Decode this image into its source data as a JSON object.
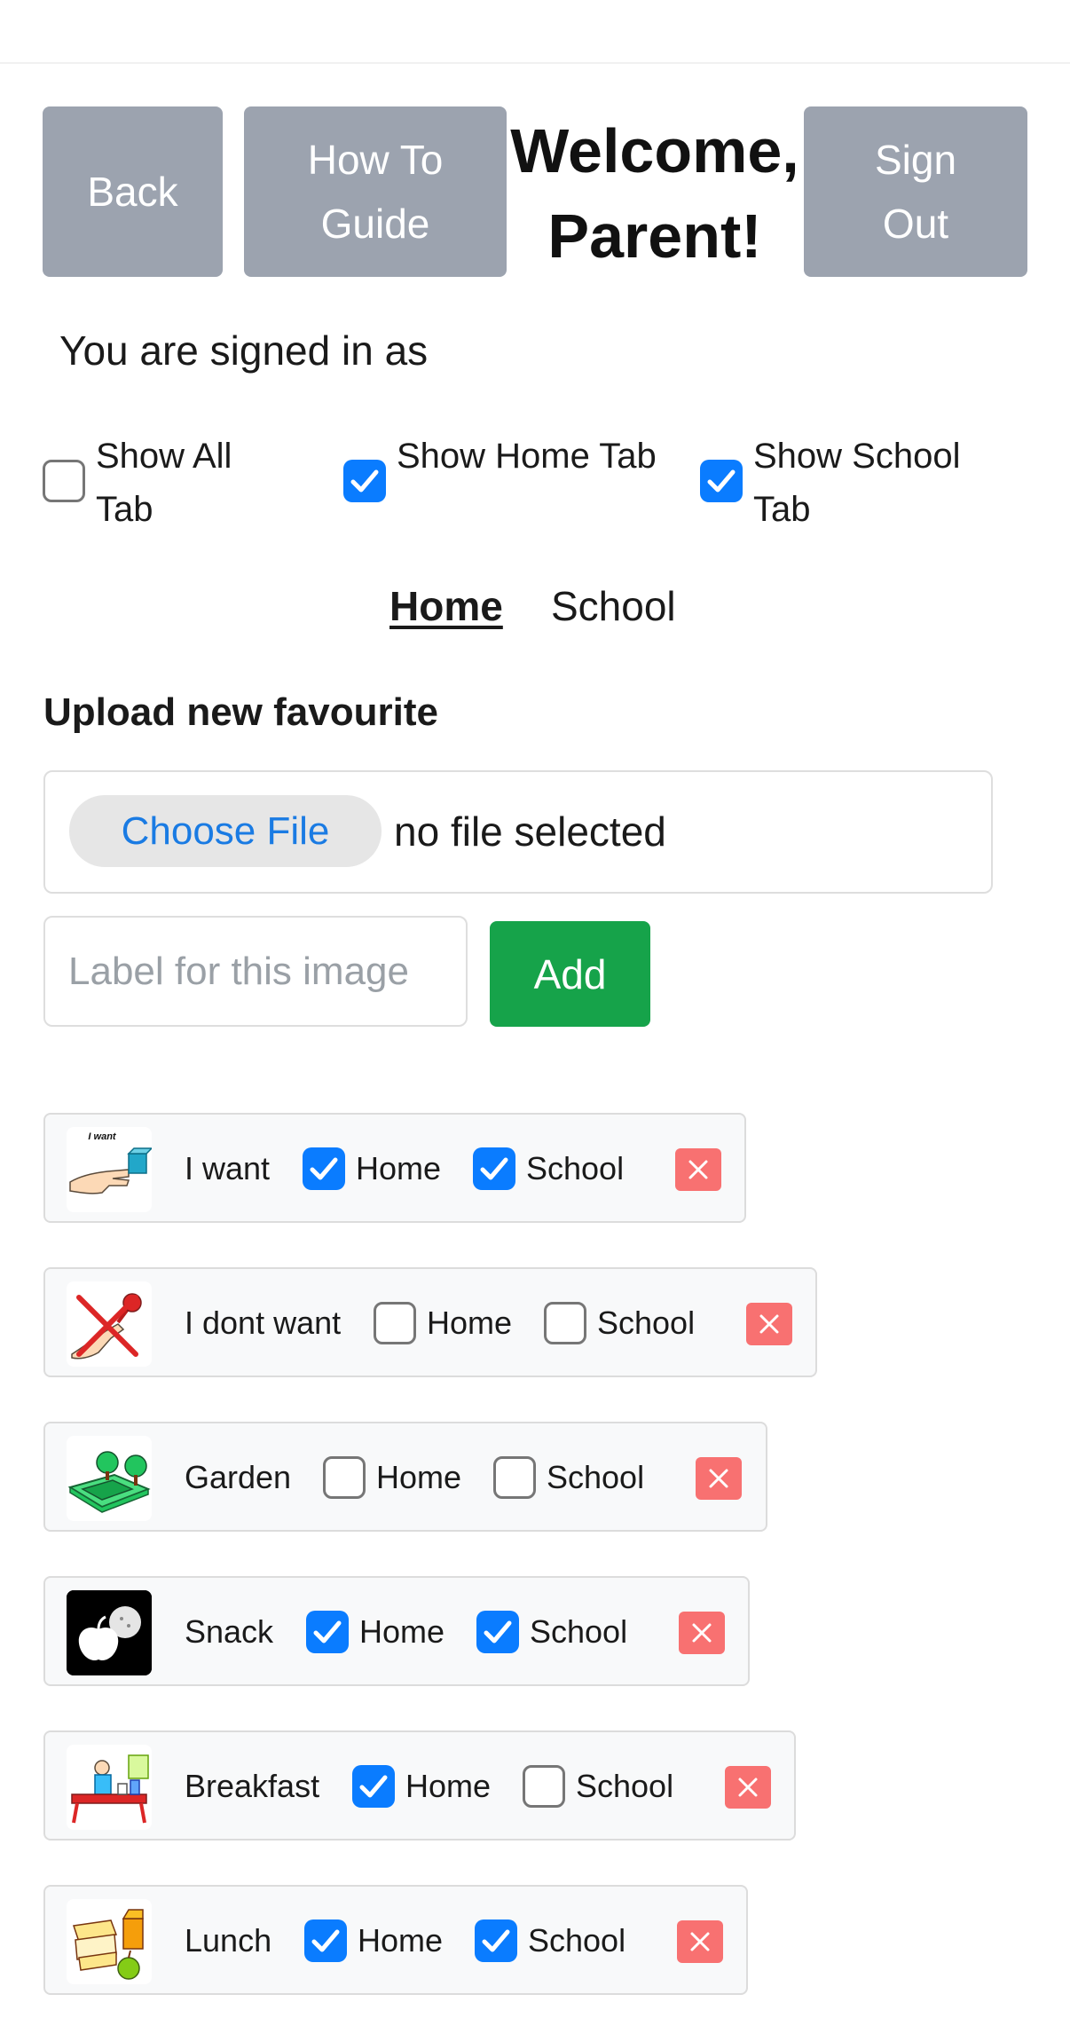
{
  "header": {
    "back_label": "Back",
    "guide_label": "How To Guide",
    "welcome": "Welcome, Parent!",
    "signout_label": "Sign Out"
  },
  "signed_in": "You are signed in as",
  "toggles": {
    "all": {
      "label": "Show All Tab",
      "checked": false
    },
    "home": {
      "label": "Show Home Tab",
      "checked": true
    },
    "school": {
      "label": "Show School Tab",
      "checked": true
    }
  },
  "tabs": {
    "home": "Home",
    "school": "School",
    "active": "Home"
  },
  "upload": {
    "title": "Upload new favourite",
    "choose_label": "Choose File",
    "file_status": "no file selected",
    "label_placeholder": "Label for this image",
    "add_label": "Add"
  },
  "favourites": [
    {
      "label": "I want",
      "home": true,
      "school": true,
      "icon": "i-want-icon"
    },
    {
      "label": "I dont want",
      "home": false,
      "school": false,
      "icon": "i-dont-want-icon"
    },
    {
      "label": "Garden",
      "home": false,
      "school": false,
      "icon": "garden-icon"
    },
    {
      "label": "Snack",
      "home": true,
      "school": true,
      "icon": "snack-icon"
    },
    {
      "label": "Breakfast",
      "home": true,
      "school": false,
      "icon": "breakfast-icon"
    },
    {
      "label": "Lunch",
      "home": true,
      "school": true,
      "icon": "lunch-icon"
    }
  ],
  "favourite_option_labels": {
    "home": "Home",
    "school": "School"
  },
  "thumb_text": {
    "i_want": "I want"
  },
  "colors": {
    "accent": "#0a7cff",
    "add": "#16a34a",
    "delete": "#f87171",
    "header_button": "#9ca3af"
  }
}
